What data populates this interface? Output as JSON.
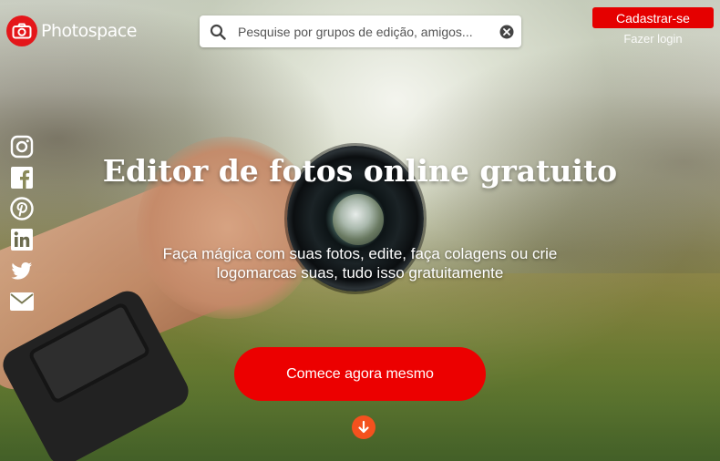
{
  "header": {
    "brand": "Photospace",
    "search_placeholder": "Pesquise por grupos de edição, amigos...",
    "signup_label": "Cadastrar-se",
    "login_label": "Fazer login"
  },
  "social": [
    "instagram-icon",
    "facebook-icon",
    "pinterest-icon",
    "linkedin-icon",
    "twitter-icon",
    "email-icon"
  ],
  "hero": {
    "title": "Editor de fotos online gratuito",
    "subtitle": "Faça mágica com suas fotos, edite, faça colagens ou crie logomarcas suas, tudo isso gratuitamente",
    "cta_label": "Comece agora mesmo"
  },
  "colors": {
    "brand_red": "#e4161a",
    "cta_red": "#ec0000",
    "scroll_orange": "#f4511e"
  }
}
